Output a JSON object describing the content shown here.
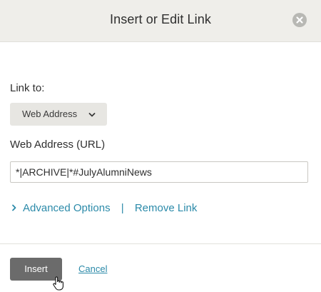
{
  "dialog": {
    "title": "Insert or Edit Link",
    "close_icon": "close-icon"
  },
  "form": {
    "link_to_label": "Link to:",
    "link_type_selected": "Web Address",
    "url_label": "Web Address (URL)",
    "url_value": "*|ARCHIVE|*#JulyAlumniNews",
    "advanced_options_label": "Advanced Options",
    "separator": "|",
    "remove_link_label": "Remove Link"
  },
  "footer": {
    "insert_label": "Insert",
    "cancel_label": "Cancel"
  },
  "colors": {
    "header_bg": "#efeeea",
    "link": "#2b8aa9",
    "primary_button": "#6b6b6b",
    "select_bg": "#e7e6e2"
  }
}
